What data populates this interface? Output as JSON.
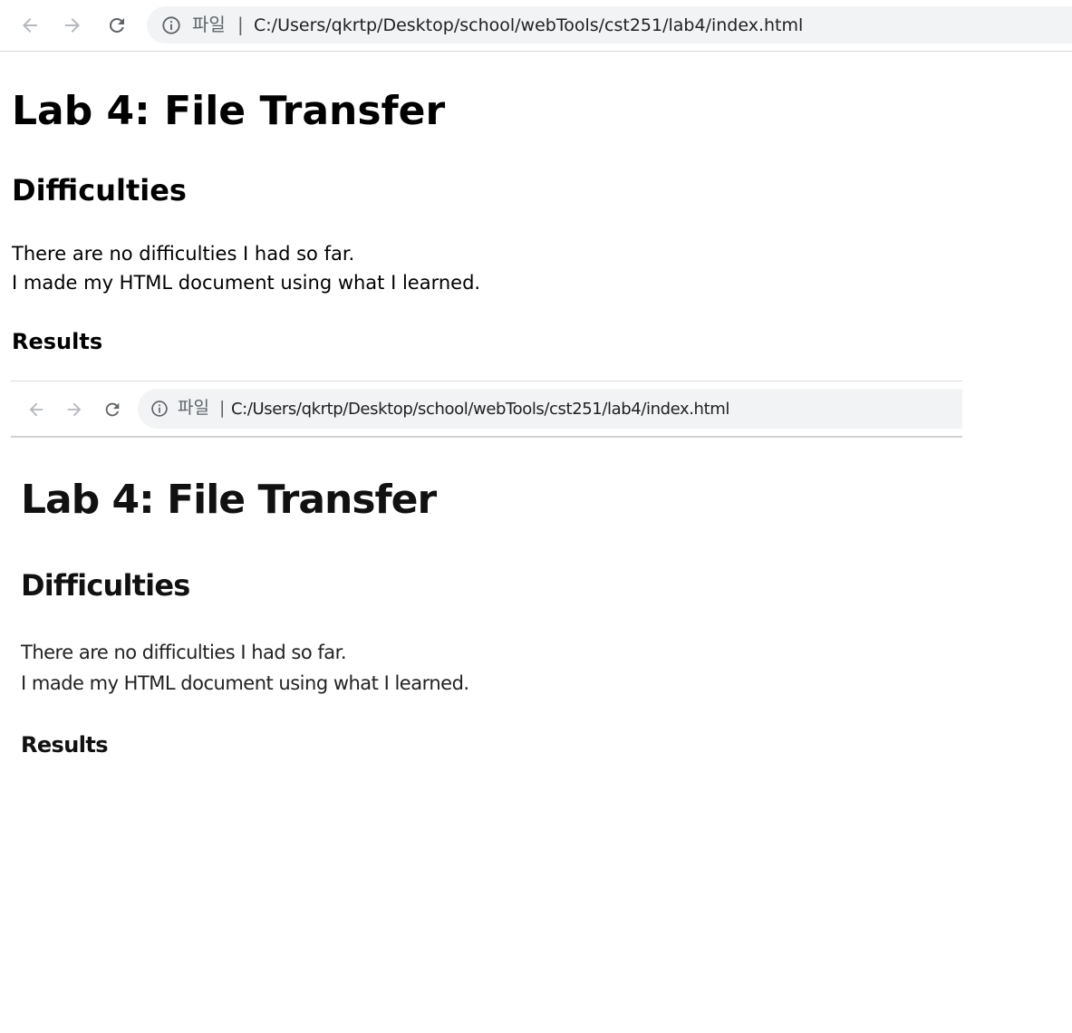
{
  "browser": {
    "scheme_label": "파일",
    "separator": "|",
    "url": "C:/Users/qkrtp/Desktop/school/webTools/cst251/lab4/index.html"
  },
  "page": {
    "title": "Lab 4: File Transfer",
    "section_heading": "Difficulties",
    "paragraph_line_1": "There are no difficulties I had so far.",
    "paragraph_line_2": "I made my HTML document using what I learned.",
    "results_heading": "Results"
  },
  "result_image": {
    "browser": {
      "scheme_label": "파일",
      "separator": "|",
      "url": "C:/Users/qkrtp/Desktop/school/webTools/cst251/lab4/index.html"
    },
    "title": "Lab 4: File Transfer",
    "section_heading": "Difficulties",
    "paragraph_line_1": "There are no difficulties I had so far.",
    "paragraph_line_2": "I made my HTML document using what I learned.",
    "results_heading": "Results"
  },
  "icons": {
    "back": "back-arrow-icon",
    "forward": "forward-arrow-icon",
    "reload": "reload-icon",
    "info": "info-icon"
  },
  "colors": {
    "omnibox_bg": "#f1f3f4",
    "icon_gray": "#5f6368",
    "icon_disabled": "#b5b8bc"
  }
}
